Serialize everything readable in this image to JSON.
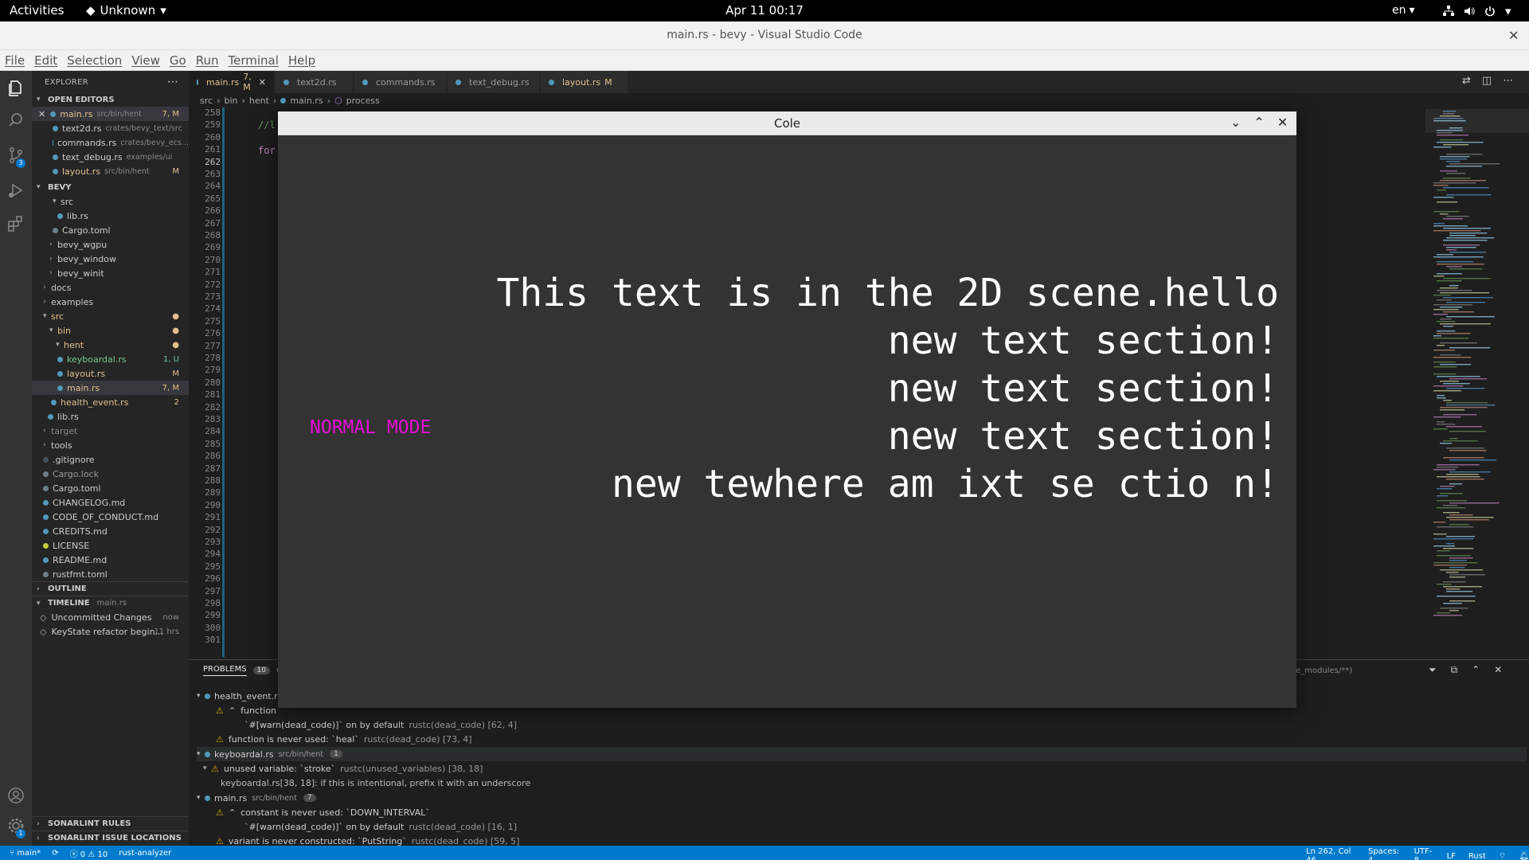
{
  "topbar": {
    "activities": "Activities",
    "app_menu": "Unknown",
    "clock": "Apr 11  00:17",
    "lang": "en"
  },
  "window": {
    "title": "main.rs - bevy - Visual Studio Code"
  },
  "menu": [
    "File",
    "Edit",
    "Selection",
    "View",
    "Go",
    "Run",
    "Terminal",
    "Help"
  ],
  "activity": {
    "source_control_badge": "3",
    "settings_badge": "1"
  },
  "sidebar": {
    "title": "EXPLORER",
    "open_editors_label": "OPEN EDITORS",
    "open_editors": [
      {
        "name": "main.rs",
        "path": "src/bin/hent",
        "status": "7, M"
      },
      {
        "name": "text2d.rs",
        "path": "crates/bevy_text/src",
        "status": ""
      },
      {
        "name": "commands.rs",
        "path": "crates/bevy_ecs...",
        "status": ""
      },
      {
        "name": "text_debug.rs",
        "path": "examples/ui",
        "status": ""
      },
      {
        "name": "layout.rs",
        "path": "src/bin/hent",
        "status": "M"
      }
    ],
    "project_label": "BEVY",
    "tree": [
      {
        "name": "src",
        "status": ""
      },
      {
        "name": "lib.rs",
        "status": ""
      },
      {
        "name": "Cargo.toml",
        "status": ""
      },
      {
        "name": "bevy_wgpu",
        "status": ""
      },
      {
        "name": "bevy_window",
        "status": ""
      },
      {
        "name": "bevy_winit",
        "status": ""
      },
      {
        "name": "docs",
        "status": ""
      },
      {
        "name": "examples",
        "status": ""
      },
      {
        "name": "src",
        "status": ""
      },
      {
        "name": "bin",
        "status": ""
      },
      {
        "name": "hent",
        "status": ""
      },
      {
        "name": "keyboardal.rs",
        "status": "1, U"
      },
      {
        "name": "layout.rs",
        "status": "M"
      },
      {
        "name": "main.rs",
        "status": "7, M"
      },
      {
        "name": "health_event.rs",
        "status": "2"
      },
      {
        "name": "lib.rs",
        "status": ""
      },
      {
        "name": "target",
        "status": ""
      },
      {
        "name": "tools",
        "status": ""
      },
      {
        "name": ".gitignore",
        "status": ""
      },
      {
        "name": "Cargo.lock",
        "status": ""
      },
      {
        "name": "Cargo.toml",
        "status": ""
      },
      {
        "name": "CHANGELOG.md",
        "status": ""
      },
      {
        "name": "CODE_OF_CONDUCT.md",
        "status": ""
      },
      {
        "name": "CREDITS.md",
        "status": ""
      },
      {
        "name": "LICENSE",
        "status": ""
      },
      {
        "name": "README.md",
        "status": ""
      },
      {
        "name": "rustfmt.toml",
        "status": ""
      }
    ],
    "outline_label": "OUTLINE",
    "timeline_label": "TIMELINE",
    "timeline_file": "main.rs",
    "timeline": [
      {
        "label": "Uncommitted Changes",
        "time": "now"
      },
      {
        "label": "KeyState refactor begin...",
        "time": "11 hrs"
      }
    ],
    "sonarlint_rules": "SONARLINT RULES",
    "sonarlint_issues": "SONARLINT ISSUE LOCATIONS"
  },
  "tabs": [
    {
      "name": "main.rs",
      "status": "7, M"
    },
    {
      "name": "text2d.rs",
      "status": ""
    },
    {
      "name": "commands.rs",
      "status": ""
    },
    {
      "name": "text_debug.rs",
      "status": ""
    },
    {
      "name": "layout.rs",
      "status": "M"
    }
  ],
  "breadcrumb": [
    "src",
    "bin",
    "hent",
    "main.rs",
    "process"
  ],
  "editor": {
    "line_numbers": [
      "258",
      "259",
      "260",
      "261",
      "262",
      "263",
      "264",
      "265",
      "266",
      "267",
      "268",
      "269",
      "270",
      "271",
      "272",
      "273",
      "274",
      "275",
      "276",
      "277",
      "278",
      "279",
      "280",
      "281",
      "282",
      "283",
      "284",
      "285",
      "286",
      "287",
      "288",
      "289",
      "290",
      "291",
      "292",
      "293",
      "294",
      "295",
      "296",
      "297",
      "298",
      "299",
      "300",
      "301"
    ],
    "current_line": "262",
    "fragment_comment": "//l",
    "fragment_for": "for"
  },
  "panel": {
    "problems_label": "PROBLEMS",
    "problems_count": "10",
    "next_tab": "O",
    "filter_text": "e_modules/**)",
    "rows": [
      {
        "text": "health_event.r",
        "detail": ""
      },
      {
        "text": "function",
        "detail": ""
      },
      {
        "text": "`#[warn(dead_code)]` on by default",
        "detail": "rustc(dead_code) [62, 4]"
      },
      {
        "text": "function is never used: `heal`",
        "detail": "rustc(dead_code) [73, 4]"
      },
      {
        "text": "keyboardal.rs",
        "detail": "src/bin/hent",
        "count": "1"
      },
      {
        "text": "unused variable: `stroke`",
        "detail": "rustc(unused_variables) [38, 18]"
      },
      {
        "text": "keyboardal.rs[38, 18]: if this is intentional, prefix it with an underscore",
        "detail": ""
      },
      {
        "text": "main.rs",
        "detail": "src/bin/hent",
        "count": "7"
      },
      {
        "text": "constant is never used: `DOWN_INTERVAL`",
        "detail": ""
      },
      {
        "text": "`#[warn(dead_code)]` on by default",
        "detail": "rustc(dead_code) [16, 1]"
      },
      {
        "text": "variant is never constructed: `PutString`",
        "detail": "rustc(dead_code) [59, 5]"
      }
    ]
  },
  "status": {
    "branch": "main*",
    "errors": "0",
    "warnings": "10",
    "analyzer": "rust-analyzer",
    "position": "Ln 262, Col 46",
    "spaces": "Spaces: 4",
    "encoding": "UTF-8",
    "eol": "LF",
    "language": "Rust"
  },
  "game": {
    "title": "Cole",
    "mode": "NORMAL MODE",
    "lines": [
      "This text is in the 2D scene.hello",
      "new text section!",
      "new text section!",
      "new text section!",
      "new tewhere am ixt se ctio n!"
    ]
  },
  "colors": {
    "mode_magenta": "#e60fd6",
    "status_blue": "#007acc",
    "modified": "#e2c08d"
  }
}
